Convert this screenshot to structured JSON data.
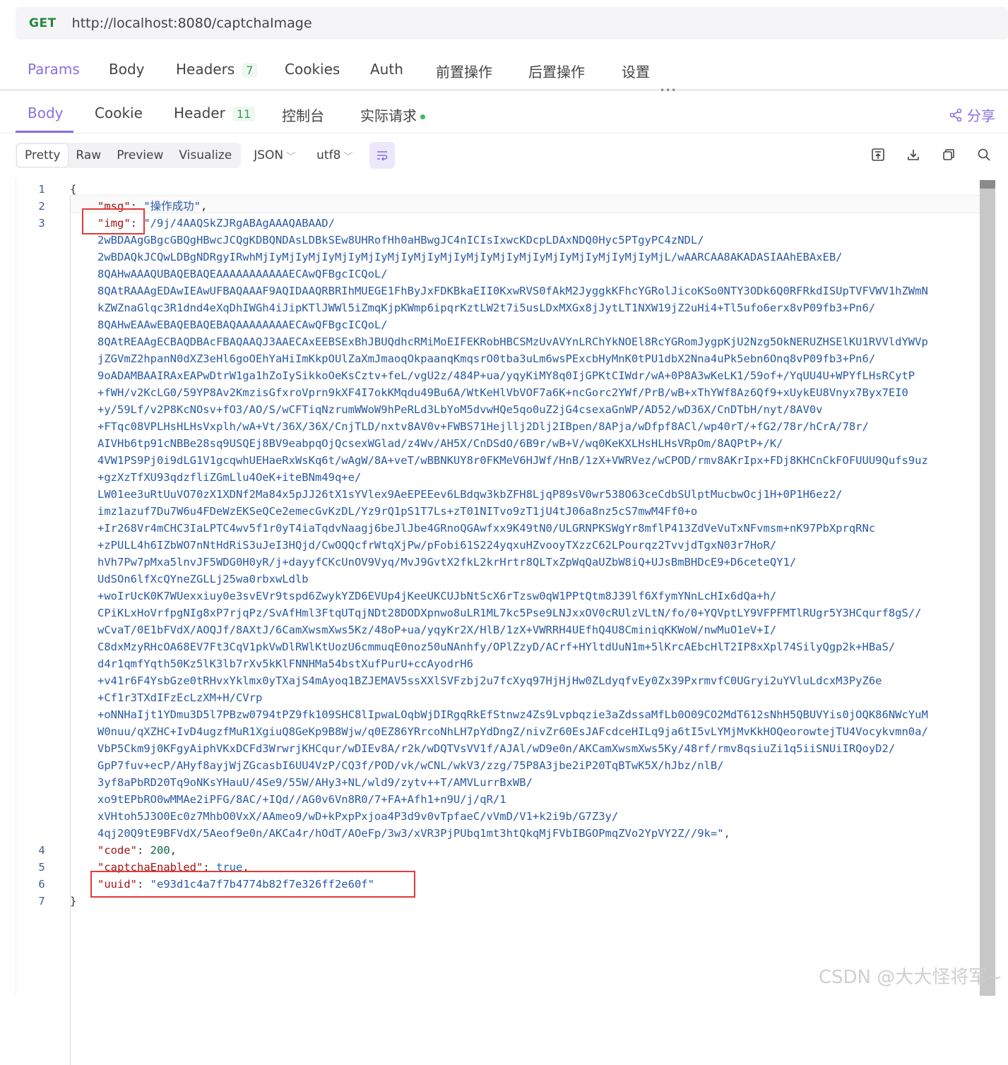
{
  "request": {
    "method": "GET",
    "url": "http://localhost:8080/captchaImage"
  },
  "request_tabs": [
    {
      "label": "Params"
    },
    {
      "label": "Body"
    },
    {
      "label": "Headers",
      "count": "7"
    },
    {
      "label": "Cookies"
    },
    {
      "label": "Auth"
    },
    {
      "label": "前置操作"
    },
    {
      "label": "后置操作"
    },
    {
      "label": "设置"
    }
  ],
  "response_tabs": [
    {
      "label": "Body"
    },
    {
      "label": "Cookie"
    },
    {
      "label": "Header",
      "count": "11"
    },
    {
      "label": "控制台"
    },
    {
      "label": "实际请求"
    }
  ],
  "share_label": "分享",
  "view_modes": [
    "Pretty",
    "Raw",
    "Preview",
    "Visualize"
  ],
  "format": "JSON",
  "encoding": "utf8",
  "code": {
    "line1": "{",
    "msg_key": "\"msg\"",
    "msg_val": "\"操作成功\"",
    "img_key": "\"img\"",
    "img_lines": [
      "\"/9j/4AAQSkZJRgABAgAAAQABAAD/",
      "2wBDAAgGBgcGBQgHBwcJCQgKDBQNDAsLDBkSEw8UHRofHh0aHBwgJC4nICIsIxwcKDcpLDAxNDQ0Hyc5PTgyPC4zNDL/",
      "2wBDAQkJCQwLDBgNDRgyIRwhMjIyMjIyMjIyMjIyMjIyMjIyMjIyMjIyMjIyMjIyMjIyMjIyMjIyMjIyMjIyMjL/wAARCAA8AKADASIAAhEBAxEB/",
      "8QAHwAAAQUBAQEBAQEAAAAAAAAAAAECAwQFBgcICQoL/",
      "8QAtRAAAgEDAwIEAwUFBAQAAAF9AQIDAAQRBRIhMUEGE1FhByJxFDKBkaEII0KxwRVS0fAkM2JyggkKFhcYGRolJicoKSo0NTY3ODk6Q0RFRkdISUpTVFVWV1hZWmN",
      "kZWZnaGlqc3R1dnd4eXqDhIWGh4iJipKTlJWWl5iZmqKjpKWmp6ipqrKztLW2t7i5usLDxMXGx8jJytLT1NXW19jZ2uHi4+Tl5ufo6erx8vP09fb3+Pn6/",
      "8QAHwEAAwEBAQEBAQEBAQAAAAAAAAECAwQFBgcICQoL/",
      "8QAtREAAgECBAQDBAcFBAQAAQJ3AAECAxEEBSExBhJBUQdhcRMiMoEIFEKRobHBCSMzUvAVYnLRChYkNOEl8RcYGRomJygpKjU2Nzg5OkNERUZHSElKU1RVVldYWVp",
      "jZGVmZ2hpanN0dXZ3eHl6goOEhYaHiImKkpOUlZaXmJmaoqOkpaanqKmqsrO0tba3uLm6wsPExcbHyMnK0tPU1dbX2Nna4uPk5ebn6Onq8vP09fb3+Pn6/",
      "9oADAMBAAIRAxEAPwDtrW1ga1hZoIySikkoOeKsCztv+feL/vgU2z/484P+ua/yqyKiMY8q0IjGPKtCIWdr/wA+0P8A3wKeLK1/59of+/YqUU4U+WPYfLHsRCytP",
      "+fWH/v2KcLG0/59YP8Av2KmzisGfxroVprn9kXF4I7okKMqdu49Bu6A/WtKeHlVbVOF7a6K+ncGorc2YWf/PrB/wB+xThYWf8Az6Qf9+xUykEU8Vnyx7Byx7EI0",
      "+y/59Lf/v2P8KcNOsv+fO3/AO/S/wCFTiqNzrumWWoW9hPeRLd3LbYoM5dvwHQe5qo0uZ2jG4csexaGnWP/AD52/wD36X/CnDTbH/nyt/8AV0v",
      "+FTqc08VPLHsHLHsVxplh/wA+Vt/36X/36X/CnjTLD/nxtv8AV0v+FWBS71Hejllj2Dlj2IBpen/8APja/wDfpf8ACl/wp40rT/+fG2/78r/hCrA/78r/",
      "AIVHb6tp91cNBBe28sq9USQEj8BV9eabpqOjQcsexWGlad/z4Wv/AH5X/CnDSdO/6B9r/wB+V/wq0KeKXLHsHLHsVRpOm/8AQPtP+/K/",
      "4VW1PS9Pj0i9dLG1V1gcqwhUEHaeRxWsKq6t/wAgW/8A+veT/wBBNKUY8r0FKMeV6HJWf/HnB/1zX+VWRVez/wCPOD/rmv8AKrIpx+FDj8KHCnCkFOFUUU9Qufs9uz",
      "+gzXzTfXU93qdzfliZGmLlu4OeK+iteBNm49q+e/",
      "LW01ee3uRtUuVO70zX1XDNf2Ma84x5pJJ26tX1sYVlex9AeEPEEev6LBdqw3kbZFH8LjqP89sV0wr538O63ceCdbSUlptMucbwOcj1H+0P1H6ez2/",
      "imz1azuf7Du7W6u4FDeWzEKSeQCe2emecGvKzDL/Yz9rQ1pS1T7Ls+zT01NITvo9zT1jU4tJ06a8nz5cS7mwM4Ff0+o",
      "+Ir268Vr4mCHC3IaLPTC4wv5f1r0yT4iaTqdvNaagj6beJlJbe4GRnoQGAwfxx9K49tN0/ULGRNPKSWgYr8mflP413ZdVeVuTxNFvmsm+nK97PbXprqRNc",
      "+zPULL4h6IZbWO7nNtHdRiS3uJeI3HQjd/CwOQQcfrWtqXjPw/pFobi61S224yqxuHZvooyTXzzC62LPourqz2TvvjdTgxN03r7HoR/",
      "hVh7Pw7pMxa5lnvJF5WDG0H0yR/j+dayyfCKcUnOV9Vyq/MvJ9GvtX2fkL2krHrtr8QLTxZpWqQaUZbW8iQ+UJsBmBHDcE9+D6ceteQY1/",
      "UdSOn6lfXcQYneZGLLj25wa0rbxwLdlb",
      "+woIrUcK0K7WUexxiuy0e3svEVr9tspd6ZwykYZD6EVUp4jKeeUKCUJbNtScX6rTzsw0qW1PPtQtm8J39lf6XfymYNnLcHIx6dQa+h/",
      "CPiKLxHoVrfpgNIg8xP7rjqPz/SvAfHml3FtqUTqjNDt28DODXpnwo8uLR1ML7kc5Pse9LNJxxOV0cRUlzVLtN/fo/0+YQVptLY9VFPFMTlRUgr5Y3HCqurf8gS//",
      "wCvaT/0E1bFVdX/AOQJf/8AXtJ/6CamXwsmXws5Kz/48oP+ua/yqyKr2X/HlB/1zX+VWRRH4UEfhQ4U8CminiqKKWoW/nwMuO1eV+I/",
      "C8dxMzyRHcOA68EV7Ft3CqV1pkVwDlRWlKtUozU6cmmuqE0noz50uNAnhfy/OPlZzyD/ACrf+HYltdUuN1m+5lKrcAEbcHlT2IP8xXpl74SilyQgp2k+HBaS/",
      "d4r1qmfYqth50Kz5lK3lb7rXv5kKlFNNHMa54bstXufPurU+ccAyodrH6",
      "+v41r6F4YsbGze0tRHvxYklmx0yTXajS4mAyoq1BZJEMAV5ssXXlSVFzbj2u7fcXyq97HjHjHw0ZLdyqfvEy0Zx39PxrmvfC0UGryi2uYVluLdcxM3PyZ6e",
      "+Cf1r3TXdIFzEcLzXM+H/CVrp",
      "+oNNHaIjt1YDmu3D5l7PBzw0794tPZ9fk109SHC8lIpwaLOqbWjDIRgqRkEfStnwz4Zs9Lvpbqzie3aZdssaMfLb0O09CO2MdT612sNhH5QBUVYis0jOQK86NWcYuM",
      "W0nuu/qXZHC+IvD4ugzfMuR1XgiuQ8GeKp9B8Wjw/q0EZ86YRrcoNhLH7pYdDngZ/nivZr60EsJAFcdceHILq9ja6tI5vLYMjMvKkHOQeorowtejTU4Vocykvmn0a/",
      "VbP5Ckm9j0KFgyAiphVKxDCFd3WrwrjKHCqur/wDIEv8A/r2k/wDQTVsVV1f/AJAl/wD9e0n/AKCamXwsmXws5Ky/48rf/rmv8qsiuZi1q5iiSNUiIRQoyD2/",
      "GpP7fuv+ecP/AHyf8ayjWjZGcasbI6UU4VzP/CQ3f/POD/vk/wCNL/wkV3/zzg/75P8A3jbe2iP20TqBTwK5X/hJbz/nlB/",
      "3yf8aPbRD20Tq9oNKsYHauU/4Se9/55W/AHy3+NL/wld9/zytv++T/AMVLurrBxWB/",
      "xo9tEPbRO0wMMAe2iPFG/8AC/+IQd//AG0v6Vn8R0/7+FA+Afh1+n9U/j/qR/1",
      "xVHtoh5J3O0Ec0z7MhbO0VxX/AAmeo9/wD+kPxpPxjoa4P3d9v0vTpfaeC/vVmD/V1+k2i9b/G7Z3y/",
      "4qj20Q9tE9BFVdX/5Aeof9e0n/AKCa4r/hOdT/AOeFp/3w3/xVR3PjPUbq1mt3htQkqMjFVbIBGOPmqZVo2YpVY2Z//9k=\","
    ],
    "code_key": "\"code\"",
    "code_val": "200",
    "captcha_key": "\"captchaEnabled\"",
    "captcha_val": "true",
    "uuid_key": "\"uuid\"",
    "uuid_val": "\"e93d1c4a7f7b4774b82f7e326ff2e60f\"",
    "line7": "}",
    "line_numbers": [
      "1",
      "2",
      "3",
      "4",
      "5",
      "6",
      "7"
    ]
  },
  "watermark": "CSDN @大大怪将军~"
}
